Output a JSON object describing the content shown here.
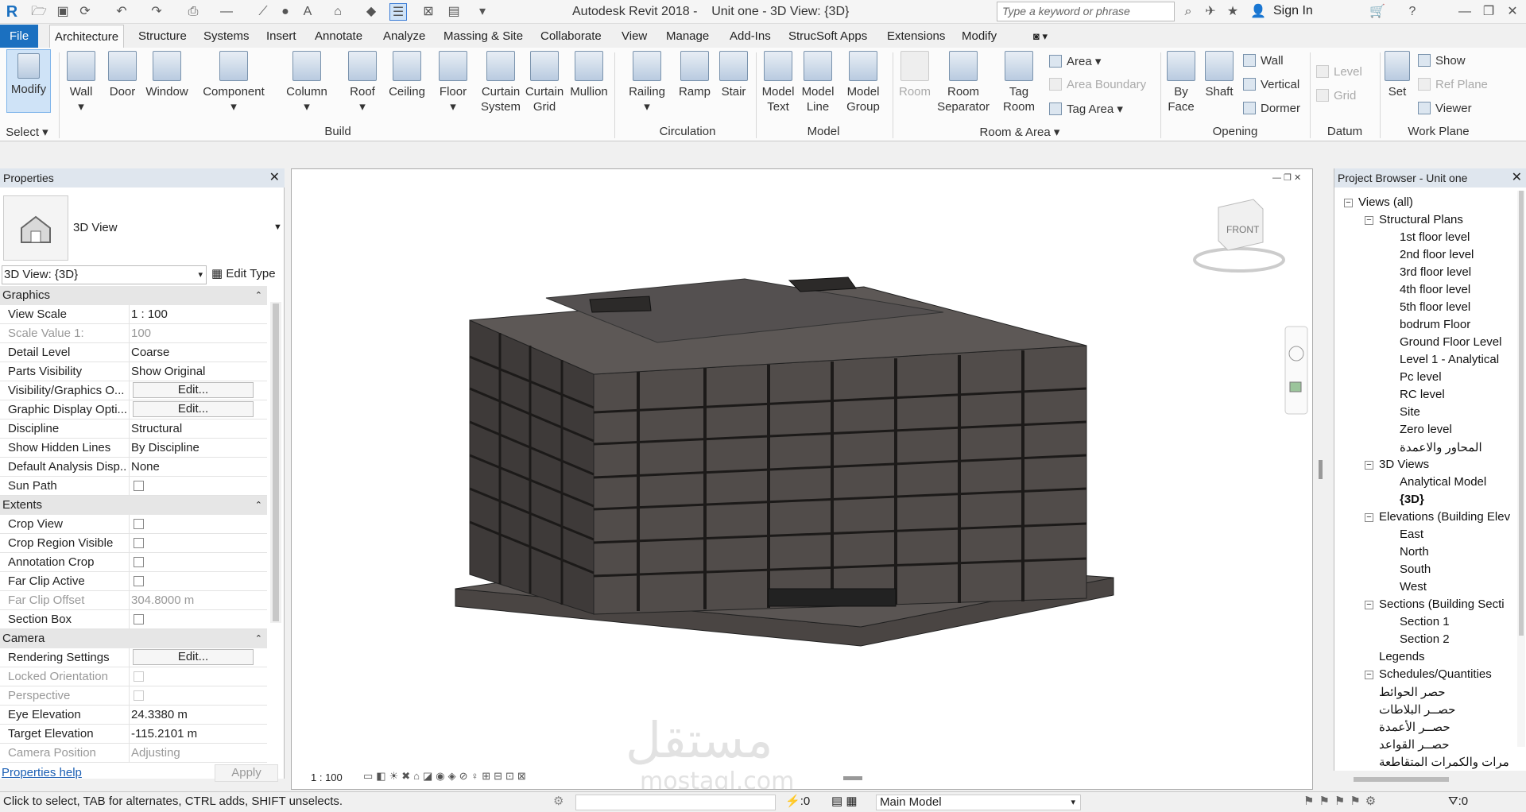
{
  "app": {
    "title": "Autodesk Revit 2018 -    Unit one - 3D View: {3D}",
    "search_placeholder": "Type a keyword or phrase",
    "sign_in": "Sign In"
  },
  "tabs": [
    "File",
    "Architecture",
    "Structure",
    "Systems",
    "Insert",
    "Annotate",
    "Analyze",
    "Massing & Site",
    "Collaborate",
    "View",
    "Manage",
    "Add-Ins",
    "StrucSoft Apps",
    "Extensions",
    "Modify"
  ],
  "active_tab": "Architecture",
  "ribbon": {
    "select": {
      "modify": "Modify",
      "select_label": "Select"
    },
    "build": [
      "Wall",
      "Door",
      "Window",
      "Component",
      "Column",
      "Roof",
      "Ceiling",
      "Floor",
      "Curtain System",
      "Curtain Grid",
      "Mullion"
    ],
    "build_group": "Build",
    "circulation": [
      "Railing",
      "Ramp",
      "Stair"
    ],
    "circulation_group": "Circulation",
    "model": [
      "Model Text",
      "Model Line",
      "Model Group"
    ],
    "model_group": "Model",
    "room": {
      "room": "Room",
      "room_separator": "Room Separator",
      "tag_room": "Tag Room",
      "area": "Area",
      "area_boundary": "Area  Boundary",
      "tag_area": "Tag  Area"
    },
    "room_group": "Room & Area",
    "opening": {
      "by_face": "By Face",
      "shaft": "Shaft",
      "wall": "Wall",
      "vertical": "Vertical",
      "dormer": "Dormer"
    },
    "opening_group": "Opening",
    "datum": {
      "level": "Level",
      "grid": "Grid"
    },
    "datum_group": "Datum",
    "workplane": {
      "set": "Set",
      "show": "Show",
      "ref_plane": "Ref  Plane",
      "viewer": "Viewer"
    },
    "workplane_group": "Work Plane"
  },
  "properties": {
    "title": "Properties",
    "type_name": "3D View",
    "view_selector": "3D View: {3D}",
    "edit_type": "Edit Type",
    "sections": {
      "graphics": "Graphics",
      "extents": "Extents",
      "camera": "Camera"
    },
    "graphics": [
      {
        "label": "View Scale",
        "value": "1 : 100"
      },
      {
        "label": "Scale Value    1:",
        "value": "100"
      },
      {
        "label": "Detail Level",
        "value": "Coarse"
      },
      {
        "label": "Parts Visibility",
        "value": "Show Original"
      },
      {
        "label": "Visibility/Graphics O...",
        "value": "Edit..."
      },
      {
        "label": "Graphic Display Opti...",
        "value": "Edit..."
      },
      {
        "label": "Discipline",
        "value": "Structural"
      },
      {
        "label": "Show Hidden Lines",
        "value": "By Discipline"
      },
      {
        "label": "Default Analysis Disp...",
        "value": "None"
      },
      {
        "label": "Sun Path",
        "value": ""
      }
    ],
    "extents": [
      {
        "label": "Crop View",
        "value": ""
      },
      {
        "label": "Crop Region Visible",
        "value": ""
      },
      {
        "label": "Annotation Crop",
        "value": ""
      },
      {
        "label": "Far Clip Active",
        "value": ""
      },
      {
        "label": "Far Clip Offset",
        "value": "304.8000 m"
      },
      {
        "label": "Section Box",
        "value": ""
      }
    ],
    "camera": [
      {
        "label": "Rendering Settings",
        "value": "Edit..."
      },
      {
        "label": "Locked Orientation",
        "value": ""
      },
      {
        "label": "Perspective",
        "value": ""
      },
      {
        "label": "Eye Elevation",
        "value": "24.3380 m"
      },
      {
        "label": "Target Elevation",
        "value": "-115.2101 m"
      },
      {
        "label": "Camera Position",
        "value": "Adjusting"
      }
    ],
    "help": "Properties help",
    "apply": "Apply"
  },
  "viewport": {
    "scale": "1 : 100",
    "viewcube_face": "FRONT",
    "watermark": "مستقل",
    "watermark_latin": "mostaql.com"
  },
  "browser": {
    "title": "Project Browser - Unit one",
    "root": "Views (all)",
    "structural_plans": "Structural Plans",
    "plans": [
      "1st floor level",
      "2nd floor level",
      "3rd floor level",
      "4th floor level",
      "5th floor level",
      "bodrum Floor",
      "Ground Floor Level",
      "Level 1 - Analytical",
      "Pc level",
      "RC level",
      "Site",
      "Zero level",
      "المحاور والاعمدة"
    ],
    "views3d": "3D Views",
    "views3d_items": [
      "Analytical Model",
      "{3D}"
    ],
    "elevations": "Elevations (Building Elev",
    "elevation_items": [
      "East",
      "North",
      "South",
      "West"
    ],
    "sections": "Sections (Building Secti",
    "section_items": [
      "Section 1",
      "Section 2"
    ],
    "legends": "Legends",
    "schedules": "Schedules/Quantities",
    "schedule_items": [
      "حصر الحوائط",
      "حصــر البلاطات",
      "حصــر الأعمدة",
      "حصــر القواعد",
      "مرات والكمرات المتقاطعة"
    ]
  },
  "status": {
    "hint": "Click to select, TAB for alternates, CTRL adds, SHIFT unselects.",
    "count": ":0",
    "model": "Main Model",
    "filter": ":0"
  }
}
